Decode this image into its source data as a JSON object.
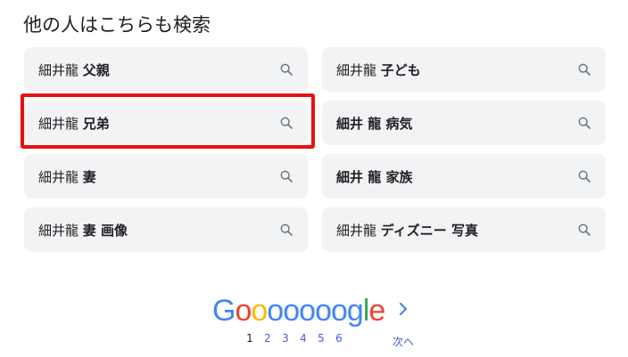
{
  "heading": "他の人はこちらも検索",
  "searches": [
    {
      "prefix": "細井龍",
      "bold": "父親"
    },
    {
      "prefix": "細井龍",
      "bold": "子ども"
    },
    {
      "prefix": "細井龍",
      "bold": "兄弟"
    },
    {
      "prefix": "",
      "bold": "細井 龍 病気"
    },
    {
      "prefix": "細井龍",
      "bold": "妻"
    },
    {
      "prefix": "",
      "bold": "細井 龍 家族"
    },
    {
      "prefix": "細井龍",
      "bold": "妻 画像"
    },
    {
      "prefix": "細井龍",
      "bold": "ディズニー 写真"
    }
  ],
  "pagination": {
    "logo": [
      "G",
      "o",
      "o",
      "o",
      "o",
      "o",
      "o",
      "o",
      "g",
      "l",
      "e"
    ],
    "current": "1",
    "pages": [
      "2",
      "3",
      "4",
      "5",
      "6"
    ],
    "next_label": "次へ"
  },
  "colors": {
    "highlight": "#e81010",
    "chip_bg": "#f1f3f4",
    "link": "#4d5bd8",
    "google_blue": "#4285f4",
    "google_red": "#ea4335",
    "google_yellow": "#fbbc05",
    "google_green": "#34a853"
  },
  "icons": {
    "chip": "search-icon",
    "next": "chevron-right-icon"
  }
}
